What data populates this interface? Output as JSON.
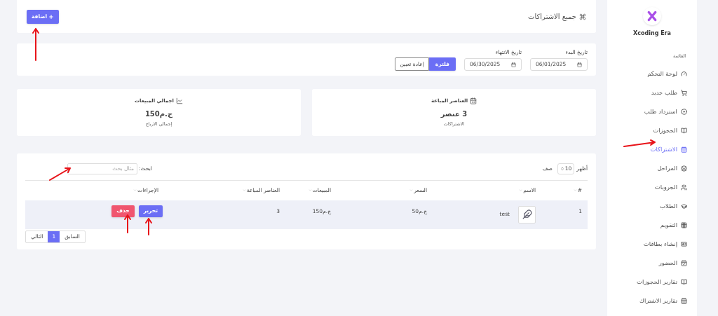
{
  "sidebar": {
    "brand": "Xcoding Era",
    "section": "القائمة",
    "items": [
      {
        "label": "لوحة التحكم",
        "selected": false
      },
      {
        "label": "طلب جديد",
        "selected": false
      },
      {
        "label": "استرداد طلب",
        "selected": false
      },
      {
        "label": "الحجوزات",
        "selected": false
      },
      {
        "label": "الاشتراكات",
        "selected": true
      },
      {
        "label": "المراحل",
        "selected": false
      },
      {
        "label": "الجروبات",
        "selected": false
      },
      {
        "label": "الطلاب",
        "selected": false
      },
      {
        "label": "التقويم",
        "selected": false
      },
      {
        "label": "إنشاء بطاقات",
        "selected": false
      },
      {
        "label": "الحضور",
        "selected": false
      },
      {
        "label": "تقارير الحجوزات",
        "selected": false
      },
      {
        "label": "تقارير الاشتراك",
        "selected": false
      }
    ]
  },
  "header": {
    "title": "جميع الاشتراكات",
    "add_button": "اضافة"
  },
  "filter": {
    "start_label": "تاريخ البدء",
    "start_value": "06/01/2025",
    "end_label": "تاريخ الانتهاء",
    "end_value": "06/30/2025",
    "filter_button": "فلترة",
    "reset_button": "إعادة تعيين"
  },
  "stats": [
    {
      "title": "العناصر المباعة",
      "value": "3 عنصر",
      "caption": "الاشتراكات"
    },
    {
      "title": "اجمالي المبيعات",
      "value": "ج.م150",
      "caption": "إجمالي الارباح"
    }
  ],
  "table": {
    "show_label": "أظهر",
    "page_size": "10",
    "rows_label": "صف",
    "search_label": "ابحث:",
    "search_placeholder": "مثال بحث",
    "columns": [
      "#",
      "الاسم",
      "السعر",
      "المبيعات",
      "العناصر المباعة",
      "الإجراءات"
    ],
    "rows": [
      {
        "index": "1",
        "name": "test",
        "price": "ج.م50",
        "sales": "ج.م150",
        "items": "3",
        "edit": "تحرير",
        "delete": "حذف"
      }
    ]
  },
  "pagination": {
    "previous": "السابق",
    "page": "1",
    "next": "التالي"
  }
}
